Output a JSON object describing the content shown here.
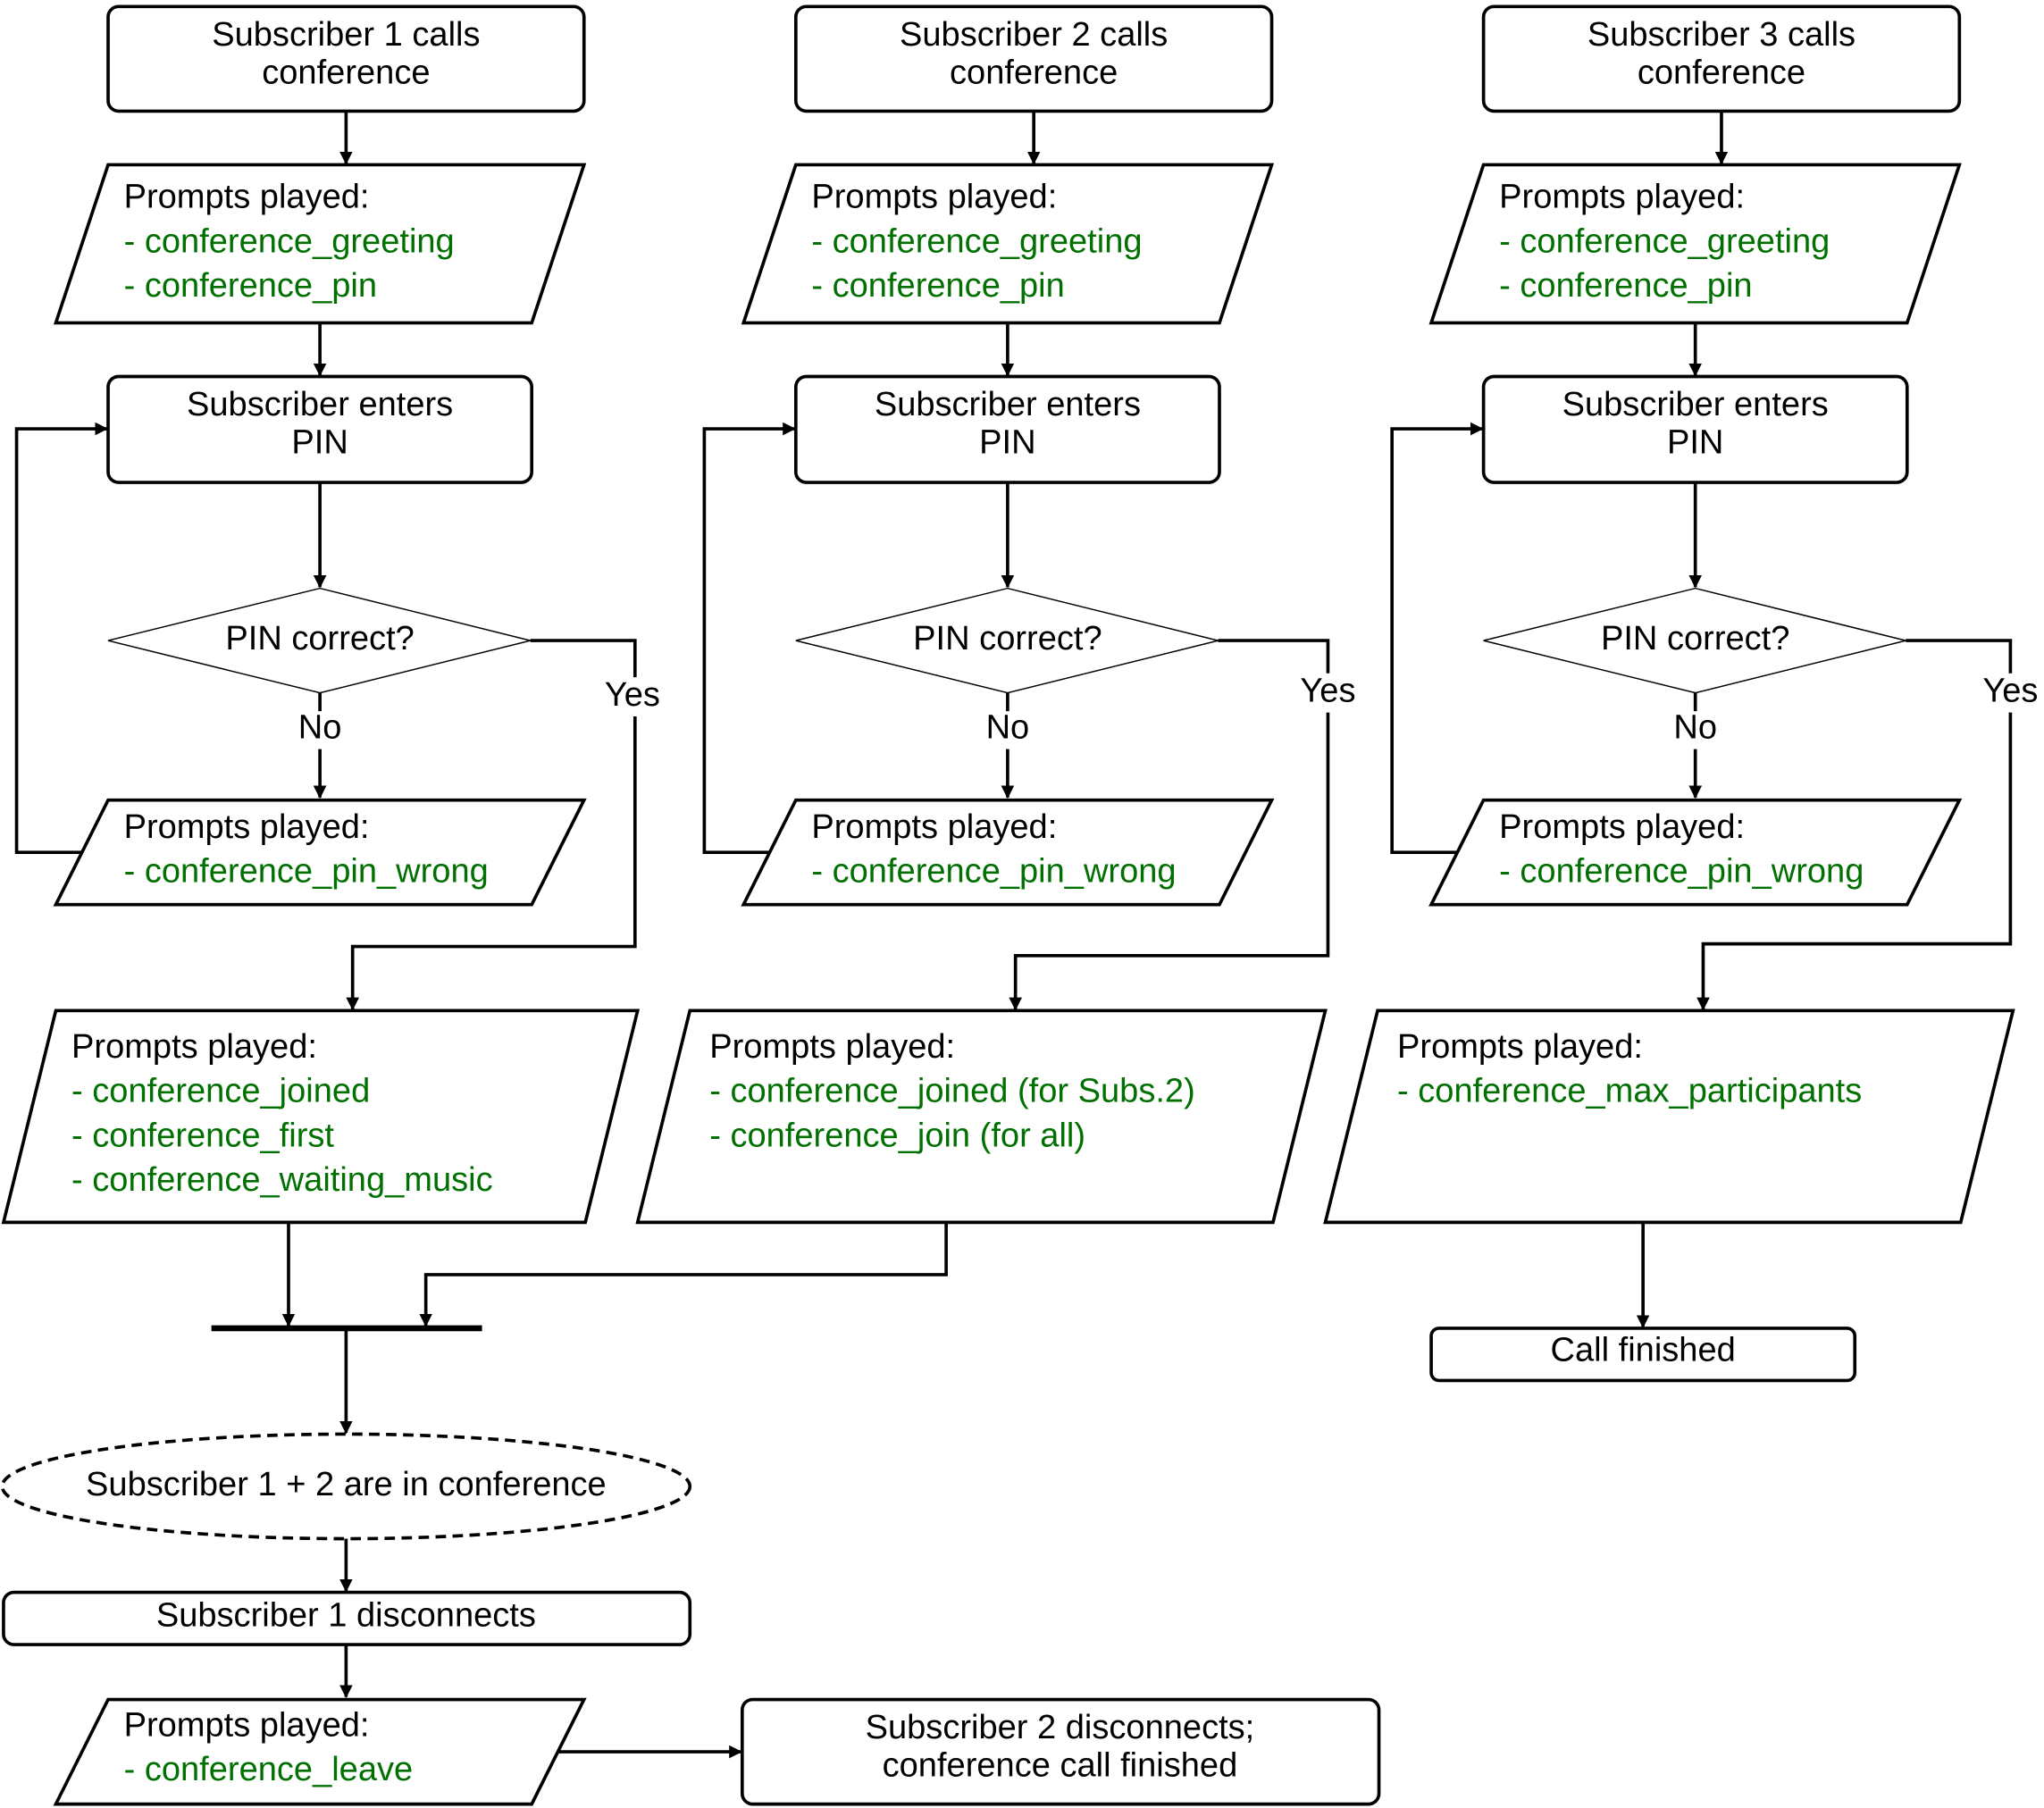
{
  "colors": {
    "prompt_text": "#007000",
    "text": "#000000",
    "stroke": "#000000"
  },
  "columns": [
    {
      "start": [
        "Subscriber 1 calls",
        "conference"
      ],
      "initial_prompts": {
        "heading": "Prompts played:",
        "items": [
          "- conference_greeting",
          "- conference_pin"
        ]
      },
      "enter_pin": [
        "Subscriber enters",
        "PIN"
      ],
      "decision": "PIN correct?",
      "no_label": "No",
      "yes_label": "Yes",
      "wrong_prompts": {
        "heading": "Prompts played:",
        "items": [
          "- conference_pin_wrong"
        ]
      },
      "result_prompts": {
        "heading": "Prompts played:",
        "items": [
          "- conference_joined",
          "- conference_first",
          "- conference_waiting_music"
        ]
      }
    },
    {
      "start": [
        "Subscriber 2 calls",
        "conference"
      ],
      "initial_prompts": {
        "heading": "Prompts played:",
        "items": [
          "- conference_greeting",
          "- conference_pin"
        ]
      },
      "enter_pin": [
        "Subscriber enters",
        "PIN"
      ],
      "decision": "PIN correct?",
      "no_label": "No",
      "yes_label": "Yes",
      "wrong_prompts": {
        "heading": "Prompts played:",
        "items": [
          "- conference_pin_wrong"
        ]
      },
      "result_prompts": {
        "heading": "Prompts played:",
        "items": [
          "- conference_joined (for Subs.2)",
          "- conference_join (for all)"
        ]
      }
    },
    {
      "start": [
        "Subscriber 3 calls",
        "conference"
      ],
      "initial_prompts": {
        "heading": "Prompts played:",
        "items": [
          "- conference_greeting",
          "- conference_pin"
        ]
      },
      "enter_pin": [
        "Subscriber enters",
        "PIN"
      ],
      "decision": "PIN correct?",
      "no_label": "No",
      "yes_label": "Yes",
      "wrong_prompts": {
        "heading": "Prompts played:",
        "items": [
          "- conference_pin_wrong"
        ]
      },
      "result_prompts": {
        "heading": "Prompts played:",
        "items": [
          "- conference_max_participants"
        ]
      }
    }
  ],
  "call_finished": "Call finished",
  "in_conference": "Subscriber 1 + 2 are in conference",
  "sub1_disconnects": "Subscriber 1 disconnects",
  "leave_prompts": {
    "heading": "Prompts played:",
    "items": [
      "- conference_leave"
    ]
  },
  "final": [
    "Subscriber 2 disconnects;",
    "conference call finished"
  ]
}
